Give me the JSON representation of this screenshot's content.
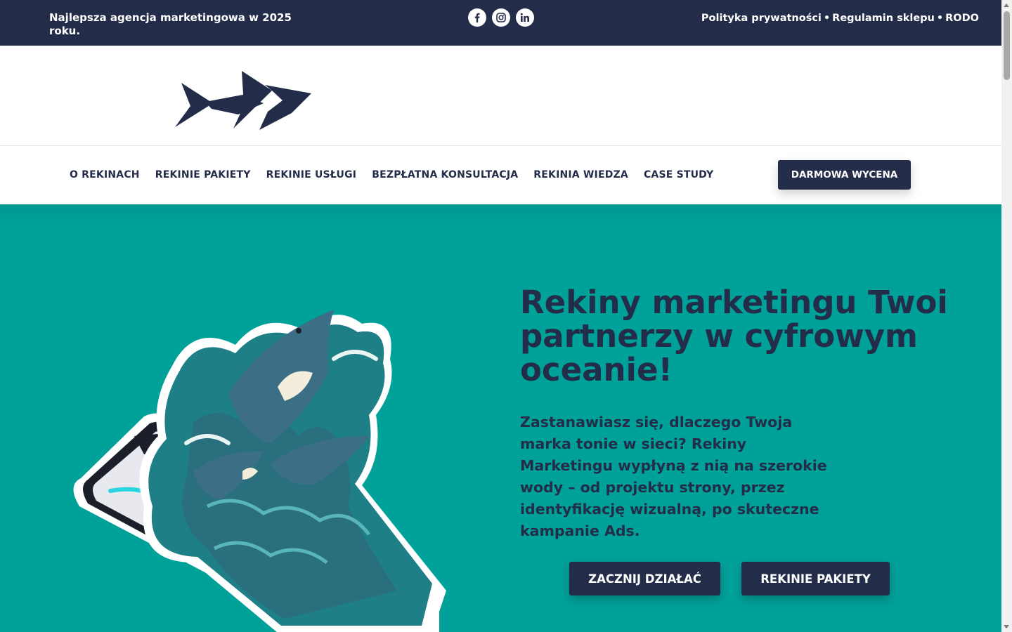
{
  "topbar": {
    "tagline": "Najlepsza agencja marketingowa w 2025 roku.",
    "socials": [
      {
        "icon": "facebook-icon"
      },
      {
        "icon": "instagram-icon"
      },
      {
        "icon": "linkedin-icon"
      }
    ],
    "legal": {
      "privacy": "Polityka prywatności",
      "terms": "Regulamin sklepu",
      "rodo": "RODO",
      "separator": "•"
    }
  },
  "logo": {
    "icon": "shark-logo-icon"
  },
  "nav": {
    "items": [
      {
        "label": "O REKINACH"
      },
      {
        "label": "REKINIE PAKIETY"
      },
      {
        "label": "REKINIE USŁUGI"
      },
      {
        "label": "BEZPŁATNA KONSULTACJA"
      },
      {
        "label": "REKINIA WIEDZA"
      },
      {
        "label": "CASE STUDY"
      }
    ],
    "cta_label": "DARMOWA WYCENA"
  },
  "hero": {
    "title": "Rekiny marketingu Twoi partnerzy w cyfrowym oceanie!",
    "text": "Zastanawiasz się, dlaczego Twoja marka tonie w sieci? Rekiny Marketingu wypłyną z nią na szerokie wody – od projektu strony, przez identyfikację wizualną, po skuteczne kampanie Ads.",
    "primary_button": "ZACZNIJ DZIAŁAĆ",
    "secondary_button": "REKINIE PAKIETY",
    "illustration": "phone-sharks-illustration"
  },
  "colors": {
    "navy": "#232c49",
    "teal": "#00a199",
    "white": "#ffffff"
  }
}
